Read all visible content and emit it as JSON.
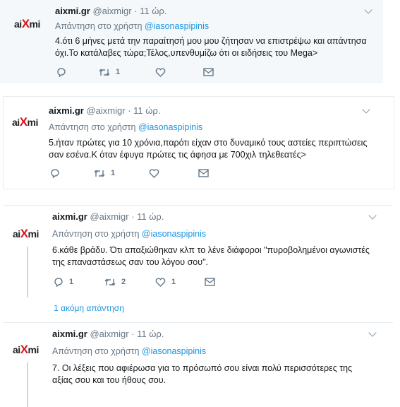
{
  "tweets": [
    {
      "avatar": {
        "a": "ai",
        "x": "X",
        "mi": "mi"
      },
      "name": "aixmi.gr",
      "handle": "@aixmigr",
      "dot": "·",
      "time": "11 ώρ.",
      "reply_prefix": "Απάντηση στο χρήστη",
      "reply_user": "@iasonaspipinis",
      "text_lines": [
        "4.ότι 6 μήνες μετά την παραίτησή μου μου ζήτησαν να επιστρέψω και απάντησα",
        "όχι.Το κατάλαβες  τώρα;Τέλος,υπενθυμίζω ότι οι ειδήσεις του Mega>"
      ],
      "counts": {
        "reply": "",
        "retweet": "1",
        "like": ""
      }
    },
    {
      "avatar": {
        "a": "ai",
        "x": "X",
        "mi": "mi"
      },
      "name": "aixmi.gr",
      "handle": "@aixmigr",
      "dot": "·",
      "time": "11 ώρ.",
      "reply_prefix": "Απάντηση στο χρήστη",
      "reply_user": "@iasonaspipinis",
      "text_lines": [
        "5.ήταν πρώτες για 10 χρόνια,παρότι είχαν στο δυναμικό τους αστείες περιπτώσεις",
        "σαν εσένα.Κ όταν έφυγα πρώτες τις άφησα με 700χιλ τηλεθεατές>"
      ],
      "counts": {
        "reply": "",
        "retweet": "1",
        "like": ""
      }
    },
    {
      "avatar": {
        "a": "ai",
        "x": "X",
        "mi": "mi"
      },
      "name": "aixmi.gr",
      "handle": "@aixmigr",
      "dot": "·",
      "time": "11 ώρ.",
      "reply_prefix": "Απάντηση στο χρήστη",
      "reply_user": "@iasonaspipinis",
      "text_lines": [
        "6.κάθε βράδυ. Ότι απαξιώθηκαν κλπ το λένε διάφοροι \"πυροβολημένοι αγωνιστές",
        "της επαναστάσεως σαν του λόγου σου\"."
      ],
      "counts": {
        "reply": "1",
        "retweet": "2",
        "like": "1"
      },
      "more_replies": "1 ακόμη απάντηση"
    },
    {
      "avatar": {
        "a": "ai",
        "x": "X",
        "mi": "mi"
      },
      "name": "aixmi.gr",
      "handle": "@aixmigr",
      "dot": "·",
      "time": "11 ώρ.",
      "reply_prefix": "Απάντηση στο χρήστη",
      "reply_user": "@iasonaspipinis",
      "text_lines": [
        "7. Οι λέξεις που αφιέρωσα για το πρόσωπό σου είναι πολύ περισσότερες της",
        "αξίας σου και του ήθους σου."
      ]
    }
  ],
  "icons": {
    "caret": "chevron-down-icon",
    "reply": "reply-icon",
    "retweet": "retweet-icon",
    "like": "heart-icon",
    "dm": "envelope-icon"
  },
  "colors": {
    "link": "#1b95e0",
    "brand_x": "#d7141a",
    "muted": "#657786",
    "panel_bg": "#f5f8fa"
  }
}
